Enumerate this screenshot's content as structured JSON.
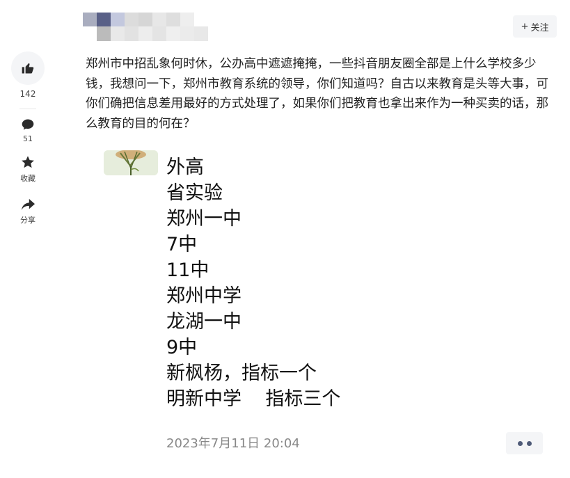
{
  "header": {
    "follow_label": "关注",
    "follow_plus": "+"
  },
  "sidebar": {
    "like_count": "142",
    "comment_count": "51",
    "favorite_label": "收藏",
    "share_label": "分享"
  },
  "post": {
    "text": "郑州市中招乱象何时休，公办高中遮遮掩掩，一些抖音朋友圈全部是上什么学校多少钱，我想问一下，郑州市教育系统的领导，你们知道吗？自古以来教育是头等大事，可你们确把信息差用最好的方式处理了，如果你们把教育也拿出来作为一种买卖的话，那么教育的目的何在？",
    "image_lines": [
      "外高",
      "省实验",
      "郑州一中",
      "7中",
      "11中",
      "郑州中学",
      "龙湖一中",
      "9中",
      "新枫杨，指标一个",
      "明新中学    指标三个"
    ],
    "timestamp": "2023年7月11日 20:04"
  },
  "colors": {
    "accent_dots": "#4f5b78",
    "button_bg": "#f4f5f7"
  }
}
